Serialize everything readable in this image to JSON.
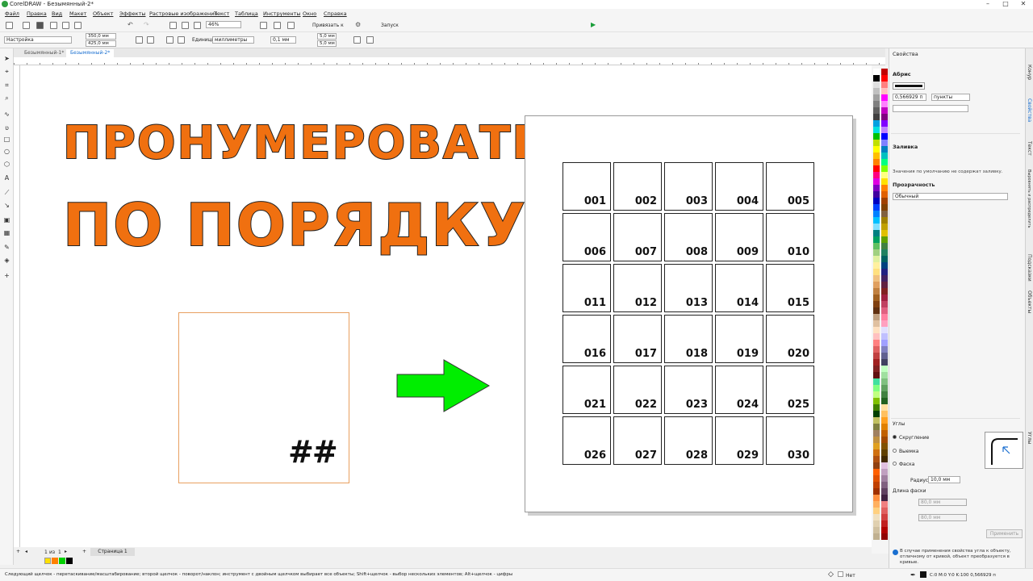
{
  "window": {
    "title": "CorelDRAW - Безымянный-2*"
  },
  "menu": [
    "Файл",
    "Правка",
    "Вид",
    "Макет",
    "Объект",
    "Эффекты",
    "Растровые изображения",
    "Текст",
    "Таблица",
    "Инструменты",
    "Окно",
    "Справка"
  ],
  "toolbar": {
    "zoom": "46%",
    "snap_label": "Привязать к",
    "launch_label": "Запуск"
  },
  "propbar": {
    "preset": "Настройка",
    "width": "350,0 мм",
    "height": "425,0 мм",
    "units_label": "Единицы:",
    "units_value": "миллиметры",
    "nudge": "0,1 мм",
    "dup_x": "5,0 мм",
    "dup_y": "5,0 мм"
  },
  "doc_tabs": [
    "Безымянный-1*",
    "Безымянный-2*"
  ],
  "canvas": {
    "heading_line1": "ПРОНУМЕРОВАТЬ",
    "heading_line2": "ПО ПОРЯДКУ",
    "source_placeholder": "##",
    "numbers": [
      "001",
      "002",
      "003",
      "004",
      "005",
      "006",
      "007",
      "008",
      "009",
      "010",
      "011",
      "012",
      "013",
      "014",
      "015",
      "016",
      "017",
      "018",
      "019",
      "020",
      "021",
      "022",
      "023",
      "024",
      "025",
      "026",
      "027",
      "028",
      "029",
      "030"
    ],
    "arrow_color": "#00ee00",
    "heading_color": "#f07010"
  },
  "page_nav": {
    "position": "1",
    "of_label": "из",
    "total": "1",
    "page_tab": "Страница 1"
  },
  "docker": {
    "title": "Свойства",
    "outline_title": "Абрис",
    "outline_width": "0,566929 п",
    "outline_units": "пункты",
    "fill_title": "Заливка",
    "fill_note": "Значения по умолчанию не содержат заливку.",
    "transparency_title": "Прозрачность",
    "transparency_mode": "Обычный"
  },
  "corners": {
    "title": "Углы",
    "options": [
      "Скругление",
      "Выемка",
      "Фаска"
    ],
    "radius_label": "Радиус:",
    "radius_value": "10,0 мм",
    "chamfer_label": "Длина фаски",
    "chamfer_x": "80,0 мм",
    "chamfer_y": "80,0 мм",
    "apply_label": "Применить",
    "info": "В случае применения свойства угла к объекту, отличному от кривой, объект преобразуется в кривые."
  },
  "right_tabs": [
    "Конур",
    "Свойства",
    "Текст",
    "Выровнять и распределить",
    "Подсказки",
    "Объекты",
    "Углы"
  ],
  "status": {
    "hint": "Следующий щелчок - перетаскивание/масштабирование; второй щелчок - поворот/наклон; инструмент с двойным щелчком выбирает все объекты; Shift+щелчок - выбор нескольких элементов; Alt+щелчок - цифры",
    "fill_none": "Нет",
    "outline_info": "C:0 M:0 Y:0 K:100  0,566929 п"
  },
  "palette_colors": [
    "#ffffff",
    "#000000",
    "#e0e0e0",
    "#c0c0c0",
    "#a0a0a0",
    "#808080",
    "#606060",
    "#404040",
    "#00a0e0",
    "#00e0e0",
    "#00c000",
    "#c0e000",
    "#ffff00",
    "#ffc000",
    "#ff8000",
    "#ff0000",
    "#ff0080",
    "#e000e0",
    "#8000c0",
    "#4000a0",
    "#0000c0",
    "#0040ff",
    "#0080ff",
    "#00c0ff",
    "#80e0ff",
    "#008080",
    "#00a060",
    "#60c060",
    "#a0d080",
    "#e0f0a0",
    "#fff0a0",
    "#ffe080",
    "#f0c080",
    "#e0a060",
    "#c08040",
    "#a06020",
    "#804010",
    "#603010",
    "#c0a080",
    "#e0c0a0",
    "#ffe0c0",
    "#ffc0c0",
    "#ff8080",
    "#e06060",
    "#c04040",
    "#a02020",
    "#802020",
    "#601010",
    "#40e0a0",
    "#80ff80",
    "#c0ff80",
    "#80c000",
    "#408000",
    "#004000",
    "#c0c060",
    "#808040",
    "#a08060",
    "#c09040",
    "#e0a020",
    "#d07010",
    "#b05010",
    "#904010",
    "#ff6000",
    "#e05000",
    "#c04000",
    "#a03000",
    "#ff9040",
    "#ffb060",
    "#ffd080",
    "#f0e0c0",
    "#e0d0b0",
    "#d0c0a0",
    "#c0b090"
  ],
  "palette_colors2": [
    "#c00000",
    "#ff0000",
    "#ff8080",
    "#ffc0c0",
    "#ff00ff",
    "#ff80ff",
    "#c000c0",
    "#800080",
    "#8000ff",
    "#c080ff",
    "#0000ff",
    "#8080ff",
    "#0080c0",
    "#00c0c0",
    "#00ff80",
    "#80ff00",
    "#ffff80",
    "#ffe000",
    "#ff8000",
    "#e06000",
    "#a04000",
    "#804000",
    "#806040",
    "#a08000",
    "#c0a000",
    "#e0c000",
    "#60a000",
    "#408040",
    "#208060",
    "#006060",
    "#004080",
    "#202080",
    "#402060",
    "#602040",
    "#802020",
    "#a02040",
    "#c04060",
    "#e06080",
    "#ff80a0",
    "#ffa0c0",
    "#e0e0ff",
    "#c0c0ff",
    "#a0a0ff",
    "#8080c0",
    "#606090",
    "#404060",
    "#c0ffc0",
    "#a0e0a0",
    "#80c080",
    "#60a060",
    "#408040",
    "#206020",
    "#ffe0a0",
    "#ffc060",
    "#ffa020",
    "#e08000",
    "#c06000",
    "#a04800",
    "#805000",
    "#604000",
    "#402800",
    "#e0c0e0",
    "#c0a0c0",
    "#a080a0",
    "#806080",
    "#604060",
    "#402040",
    "#f08080",
    "#e06060",
    "#d04040",
    "#c02020",
    "#b00000",
    "#900000"
  ]
}
